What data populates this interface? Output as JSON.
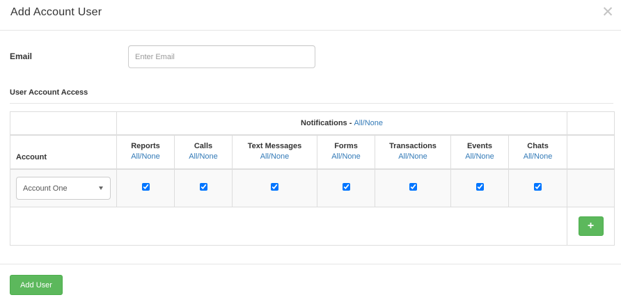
{
  "modal": {
    "title": "Add Account User",
    "close_icon": "close-icon"
  },
  "form": {
    "email_label": "Email",
    "email_placeholder": "Enter Email",
    "email_value": "",
    "access_label": "User Account Access"
  },
  "table": {
    "notifications_label": "Notifications -",
    "all_none": "All/None",
    "account_header": "Account",
    "columns": [
      "Reports",
      "Calls",
      "Text Messages",
      "Forms",
      "Transactions",
      "Events",
      "Chats"
    ],
    "rows": [
      {
        "account": "Account One",
        "checks": [
          true,
          true,
          true,
          true,
          true,
          true,
          true
        ]
      }
    ],
    "add_row_icon": "plus-icon"
  },
  "footer": {
    "add_user_label": "Add User"
  },
  "colors": {
    "primary_green": "#5cb85c",
    "link_blue": "#337ab7",
    "border": "#dddddd"
  }
}
